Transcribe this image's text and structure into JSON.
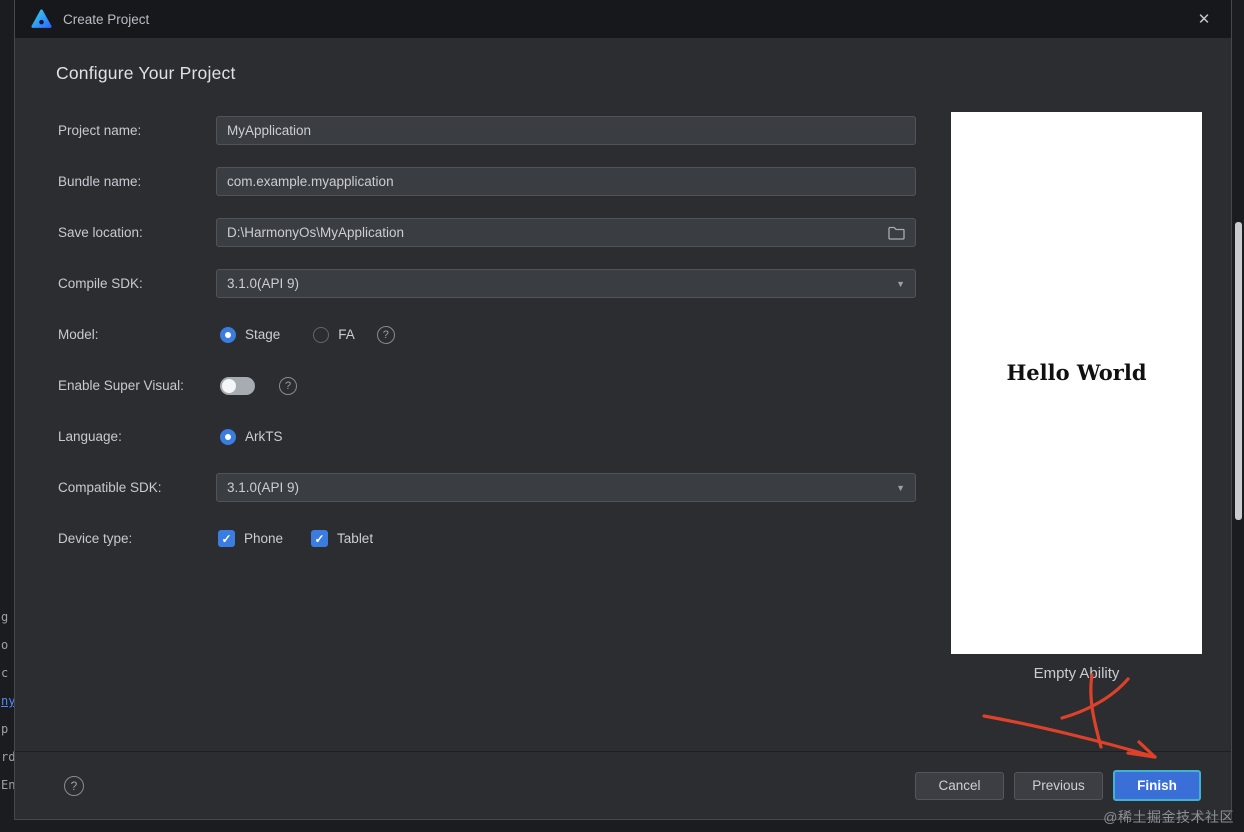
{
  "titlebar": {
    "title": "Create Project",
    "close_glyph": "✕"
  },
  "heading": "Configure Your Project",
  "ui": {
    "check_glyph": "✓",
    "dropdown_glyph": "▼",
    "help_glyph": "?"
  },
  "fields": {
    "project_name": {
      "label": "Project name:",
      "value": "MyApplication"
    },
    "bundle_name": {
      "label": "Bundle name:",
      "value": "com.example.myapplication"
    },
    "save_location": {
      "label": "Save location:",
      "value": "D:\\HarmonyOs\\MyApplication"
    },
    "compile_sdk": {
      "label": "Compile SDK:",
      "value": "3.1.0(API 9)"
    },
    "model": {
      "label": "Model:",
      "options": [
        "Stage",
        "FA"
      ],
      "selected": "Stage"
    },
    "enable_super_visual": {
      "label": "Enable Super Visual:",
      "state": "off"
    },
    "language": {
      "label": "Language:",
      "options": [
        "ArkTS"
      ],
      "selected": "ArkTS"
    },
    "compatible_sdk": {
      "label": "Compatible SDK:",
      "value": "3.1.0(API 9)"
    },
    "device_type": {
      "label": "Device type:",
      "options": [
        {
          "label": "Phone",
          "checked": true
        },
        {
          "label": "Tablet",
          "checked": true
        }
      ]
    }
  },
  "preview": {
    "text": "Hello World",
    "caption": "Empty Ability"
  },
  "footer": {
    "cancel_label": "Cancel",
    "previous_label": "Previous",
    "finish_label": "Finish"
  },
  "watermark": "@稀土掘金技术社区",
  "colors": {
    "accent": "#3b7ce0",
    "annotation": "#e8432a",
    "finish_ring": "#3fb3cf"
  },
  "background": {
    "fragments": [
      "g",
      "o",
      "c",
      "ny",
      "p",
      "rd",
      "En"
    ]
  }
}
